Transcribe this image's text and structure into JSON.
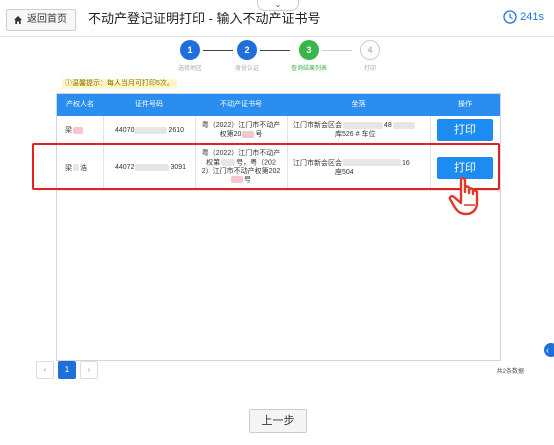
{
  "header": {
    "collapse_glyph": "⌄",
    "back_label": "返回首页",
    "title": "不动产登记证明打印 - 输入不动产证书号",
    "timer": "241s"
  },
  "steps": [
    {
      "num": "1",
      "label": "选择地区",
      "state": "done"
    },
    {
      "num": "2",
      "label": "身份认证",
      "state": "done"
    },
    {
      "num": "3",
      "label": "查询结果列表",
      "state": "current"
    },
    {
      "num": "4",
      "label": "打印",
      "state": "todo"
    }
  ],
  "hint": "ⓘ温馨提示：每人当月可打印5次。",
  "table": {
    "headers": [
      "产权人名",
      "证件号码",
      "不动产证书号",
      "坐落",
      "操作"
    ],
    "rows": [
      {
        "owner": "梁",
        "id_prefix": "44070",
        "id_suffix": "2610",
        "cert_lines": [
          "粤（2022）江门市不动产",
          "权第20",
          "号"
        ],
        "addr_lines": [
          "江门市新会区会",
          "48",
          "库526 # 车位"
        ],
        "action": "打印"
      },
      {
        "owner": "梁",
        "owner_suffix": "浩",
        "id_prefix": "44072",
        "id_suffix": "3091",
        "cert_lines": [
          "粤（2022）江门市不动产",
          "权第",
          "号，粤（202",
          "2）江门市不动产权第202",
          "号"
        ],
        "addr_lines": [
          "江门市新会区会",
          "16",
          "座504"
        ],
        "action": "打印"
      }
    ]
  },
  "pagination": {
    "prev": "‹",
    "current": "1",
    "next": "›",
    "total": "共2条数据"
  },
  "footer": {
    "prev_step": "上一步"
  },
  "colors": {
    "accent": "#1e6fd9",
    "header_bg": "#2a8ef0",
    "current_step": "#39b54a",
    "highlight": "#e62020"
  }
}
